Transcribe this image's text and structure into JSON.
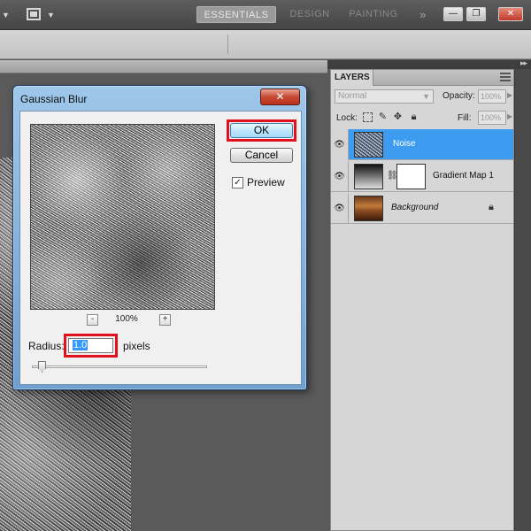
{
  "app_bar": {
    "workspaces": [
      "ESSENTIALS",
      "DESIGN",
      "PAINTING"
    ],
    "more_label": "»",
    "window_controls": {
      "minimize": "—",
      "restore": "❐",
      "close": "✕"
    }
  },
  "dialog": {
    "title": "Gaussian Blur",
    "close_label": "✕",
    "ok_label": "OK",
    "cancel_label": "Cancel",
    "preview_label": "Preview",
    "preview_checked": true,
    "zoom_out_label": "-",
    "zoom_in_label": "+",
    "zoom_level": "100%",
    "radius_label": "Radius:",
    "radius_value": "1.0",
    "radius_unit": "pixels",
    "highlight_color": "#e0101c"
  },
  "layers_panel": {
    "tab_label": "LAYERS",
    "blend_mode": "Normal",
    "opacity_label": "Opacity:",
    "opacity_value": "100%",
    "lock_label": "Lock:",
    "fill_label": "Fill:",
    "fill_value": "100%",
    "layers": [
      {
        "name": "Noise",
        "selected": true,
        "visible": true
      },
      {
        "name": "Gradient Map 1",
        "selected": false,
        "visible": true
      },
      {
        "name": "Background",
        "selected": false,
        "visible": true,
        "locked": true
      }
    ],
    "selection_color": "#3d9cf0"
  }
}
